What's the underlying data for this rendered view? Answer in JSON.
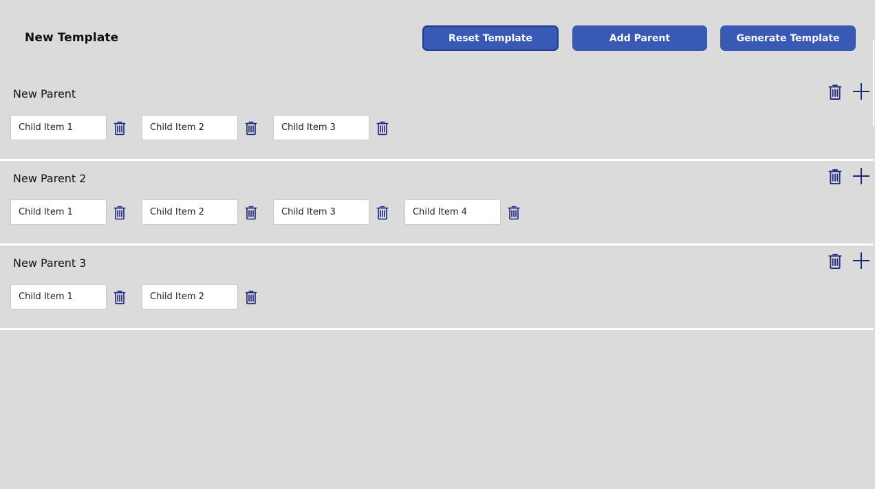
{
  "header": {
    "title": "New Template",
    "reset_label": "Reset Template",
    "add_parent_label": "Add Parent",
    "generate_label": "Generate Template"
  },
  "icons": {
    "delete": "trash-icon",
    "add": "plus-icon",
    "color": "#1a237e"
  },
  "parents": [
    {
      "name": "New Parent",
      "children": [
        "Child Item 1",
        "Child Item 2",
        "Child Item 3"
      ]
    },
    {
      "name": "New Parent 2",
      "children": [
        "Child Item 1",
        "Child Item 2",
        "Child Item 3",
        "Child Item 4"
      ]
    },
    {
      "name": "New Parent 3",
      "children": [
        "Child Item 1",
        "Child Item 2"
      ]
    }
  ],
  "colors": {
    "background": "#dbdbdb",
    "button": "#385ab4",
    "icon": "#1a237e"
  }
}
